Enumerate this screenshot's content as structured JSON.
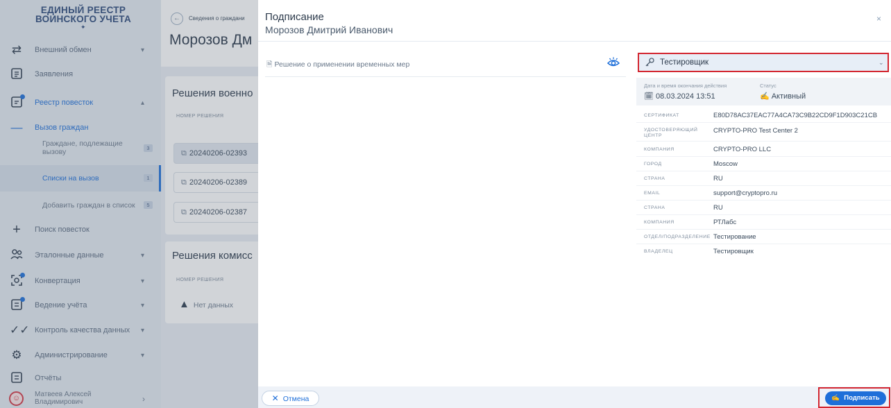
{
  "sidebar": {
    "logo_line1": "ЕДИНЫЙ РЕЕСТР",
    "logo_line2": "ВОИНСКОГО УЧЕТА",
    "items": [
      {
        "label": "Внешний обмен",
        "icon": "exchange-icon"
      },
      {
        "label": "Заявления",
        "icon": "document-list-icon"
      },
      {
        "label": "Реестр повесток",
        "icon": "registry-icon"
      },
      {
        "label": "Вызов граждан"
      },
      {
        "label": "Граждане, подлежащие вызову",
        "badge": "3"
      },
      {
        "label": "Списки на вызов",
        "badge": "1"
      },
      {
        "label": "Добавить граждан в список",
        "badge": "5"
      },
      {
        "label": "Поиск повесток",
        "icon": "plus-icon"
      },
      {
        "label": "Эталонные данные",
        "icon": "users-icon"
      },
      {
        "label": "Конвертация",
        "icon": "convert-icon"
      },
      {
        "label": "Ведение учёта",
        "icon": "accounting-icon"
      },
      {
        "label": "Контроль качества данных",
        "icon": "check-icon"
      },
      {
        "label": "Администрирование",
        "icon": "gear-icon"
      },
      {
        "label": "Отчёты",
        "icon": "report-icon"
      }
    ],
    "user": {
      "line1": "Матвеев Алексей",
      "line2": "Владимирович"
    }
  },
  "background": {
    "breadcrumb": "Сведения о граждани",
    "person_title": "Морозов Дм",
    "section1_title": "Решения военно",
    "col_head1": "НОМЕР РЕШЕНИЯ",
    "decisions": [
      "20240206-02393",
      "20240206-02389",
      "20240206-02387"
    ],
    "section2_title": "Решения комисс",
    "col_head2": "НОМЕР РЕШЕНИЯ",
    "no_data": "Нет данных"
  },
  "modal": {
    "title": "Подписание",
    "subtitle": "Морозов Дмитрий Иванович",
    "document_link": "Решение о применении временных мер",
    "certificate": {
      "selected": "Тестировщик",
      "expiry_label": "Дата и время окончания действия",
      "expiry_value": "08.03.2024 13:51",
      "status_label": "Статус",
      "status_value": "Активный"
    },
    "properties": [
      {
        "key": "СЕРТИФИКАТ",
        "value": "E80D78AC37EAC77A4CA73C9B22CD9F1D903C21CB"
      },
      {
        "key": "УДОСТОВЕРЯЮЩИЙ ЦЕНТР",
        "value": "CRYPTO-PRO Test Center 2"
      },
      {
        "key": "КОМПАНИЯ",
        "value": "CRYPTO-PRO LLC"
      },
      {
        "key": "ГОРОД",
        "value": "Moscow"
      },
      {
        "key": "СТРАНА",
        "value": "RU"
      },
      {
        "key": "EMAIL",
        "value": "support@cryptopro.ru"
      },
      {
        "key": "СТРАНА",
        "value": "RU"
      },
      {
        "key": "КОМПАНИЯ",
        "value": "РТЛабс"
      },
      {
        "key": "ОТДЕЛ/ПОДРАЗДЕЛЕНИЕ",
        "value": "Тестирование"
      },
      {
        "key": "ВЛАДЕЛЕЦ",
        "value": "Тестировщик"
      }
    ],
    "cancel_label": "Отмена",
    "sign_label": "Подписать",
    "close_icon": "×"
  },
  "colors": {
    "accent": "#1e6fd9",
    "highlight": "#d32630",
    "sidebar_bg": "#e4eaf2"
  }
}
